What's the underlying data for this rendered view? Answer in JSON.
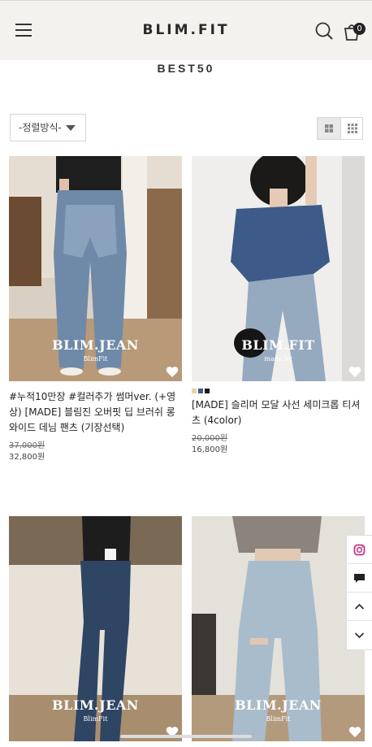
{
  "header": {
    "logo": "BLIM.FIT",
    "cart_count": "0",
    "icons": [
      "hamburger-menu-icon",
      "search-icon",
      "cart-icon"
    ]
  },
  "page": {
    "title": "BEST50"
  },
  "toolbar": {
    "sort_label": "-정렬방식-",
    "view_modes": [
      "grid-2-icon",
      "grid-3-icon"
    ]
  },
  "products": [
    {
      "name": "#누적10만장 #컬러추가 썸머ver. (+영상) [MADE] 블림진 오버핏 딥 브러쉬 롱 와이드 데님 팬츠 (기장선택)",
      "price_original": "37,000원",
      "price_sale": "32,800원",
      "overlay_brand": "BLIM.JEAN",
      "overlay_sub": "BlimFit",
      "swatches": []
    },
    {
      "name": "[MADE] 슬리머 모달 사선 세미크롭 티셔츠 (4color)",
      "price_original": "20,000원",
      "price_sale": "16,800원",
      "overlay_brand": "BLIM.FIT",
      "overlay_sub": "made by",
      "swatches": [
        "#e8d3a8",
        "#3e5a8a",
        "#1a1a1a"
      ]
    },
    {
      "name": "",
      "price_original": "",
      "price_sale": "",
      "overlay_brand": "BLIM.JEAN",
      "overlay_sub": "BlimFit",
      "swatches": []
    },
    {
      "name": "",
      "price_original": "",
      "price_sale": "",
      "overlay_brand": "BLIM.JEAN",
      "overlay_sub": "BlimFit",
      "swatches": []
    }
  ],
  "quick_menu": [
    "instagram-icon",
    "chat-icon",
    "scroll-up-icon",
    "scroll-down-icon"
  ],
  "colors": {
    "header_bg": "#f4f2ee",
    "instagram": "#c13584",
    "text": "#222222"
  }
}
